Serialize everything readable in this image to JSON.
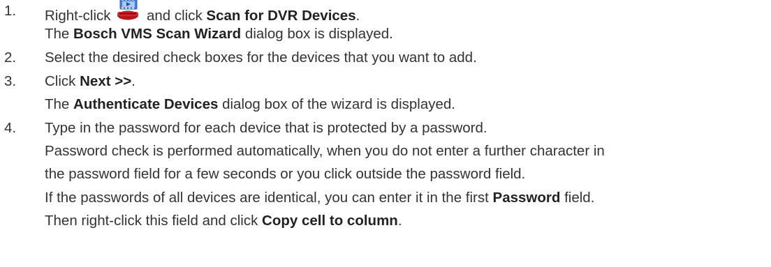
{
  "steps": [
    {
      "number": "1.",
      "lines": [
        {
          "a": "Right-click ",
          "b": " and click ",
          "bold": "Scan for DVR Devices",
          "c": "."
        },
        {
          "a": "The ",
          "bold": "Bosch VMS Scan Wizard",
          "c": " dialog box is displayed."
        }
      ]
    },
    {
      "number": "2.",
      "lines": [
        {
          "a": "Select the desired check boxes for the devices that you want to add."
        }
      ]
    },
    {
      "number": "3.",
      "lines": [
        {
          "a": "Click ",
          "bold": "Next >>",
          "c": "."
        },
        {
          "a": "The ",
          "bold": "Authenticate Devices",
          "c": " dialog box of the wizard is displayed."
        }
      ]
    },
    {
      "number": "4.",
      "lines": [
        {
          "a": "Type in the password for each device that is protected by a password."
        },
        {
          "a": "Password check is performed automatically, when you do not enter a further character in"
        },
        {
          "a": "the password field for a few seconds or you click outside the password field."
        },
        {
          "a": "If the passwords of all devices are identical, you can enter it in the first ",
          "bold": "Password",
          "c": " field."
        },
        {
          "a": "Then right-click this field and click ",
          "bold": "Copy cell to column",
          "c": "."
        }
      ]
    }
  ],
  "icons": {
    "dvr_icon": "dvr-device-icon"
  },
  "colors": {
    "text": "#333333",
    "icon_film": "#4a7fd4",
    "icon_device": "#b5161b"
  }
}
